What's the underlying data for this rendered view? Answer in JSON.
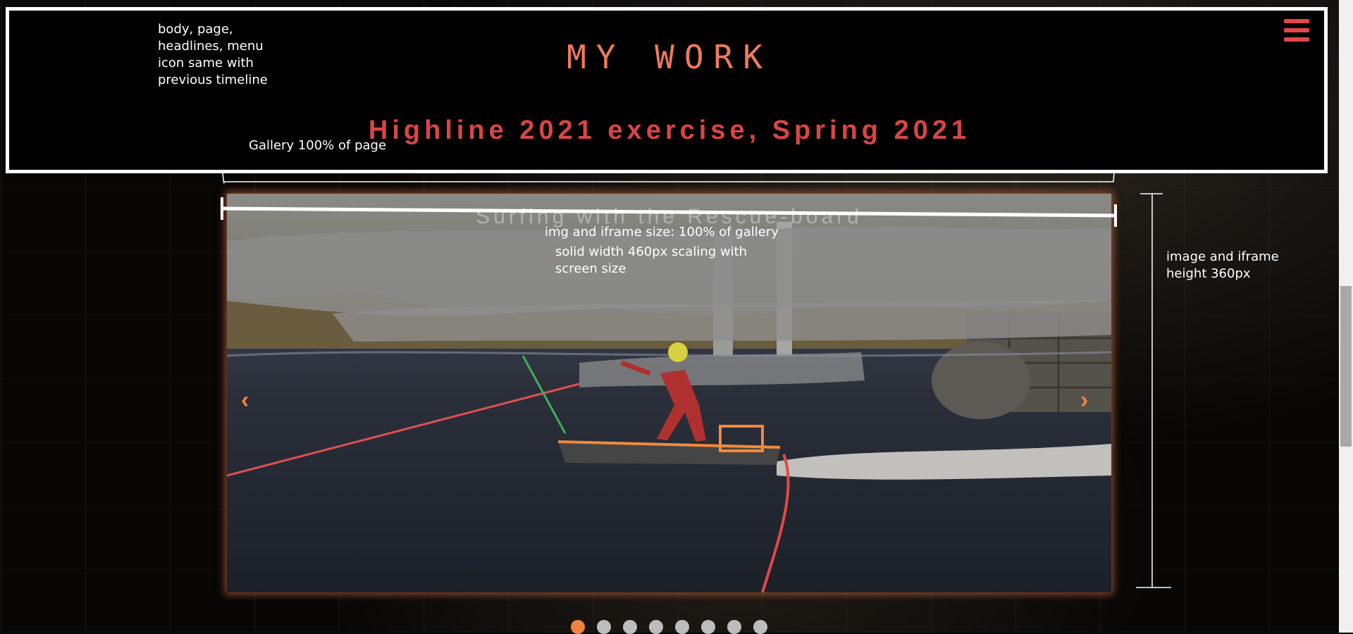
{
  "header": {
    "title": "MY WORK",
    "subtitle": "Highline 2021 exercise, Spring 2021"
  },
  "annotations": {
    "body_note": "body, page, headlines, menu icon same with previous timeline",
    "gallery_note": "Gallery 100% of page",
    "img_note": "img and iframe size: 100% of gallery",
    "solid_note": "solid width 460px scaling with screen size",
    "height_note": "image and iframe height 360px"
  },
  "gallery": {
    "slide_caption": "Surfing with the Rescue-board",
    "prev_label": "‹",
    "next_label": "›",
    "slide_count": 8,
    "active_slide": 1
  },
  "icons": {
    "menu": "hamburger-menu-icon",
    "prev": "chevron-left-icon",
    "next": "chevron-right-icon"
  },
  "colors": {
    "title": "#f07a5a",
    "subtitle": "#d94545",
    "menu": "#e04848",
    "accent": "#f0843e"
  }
}
